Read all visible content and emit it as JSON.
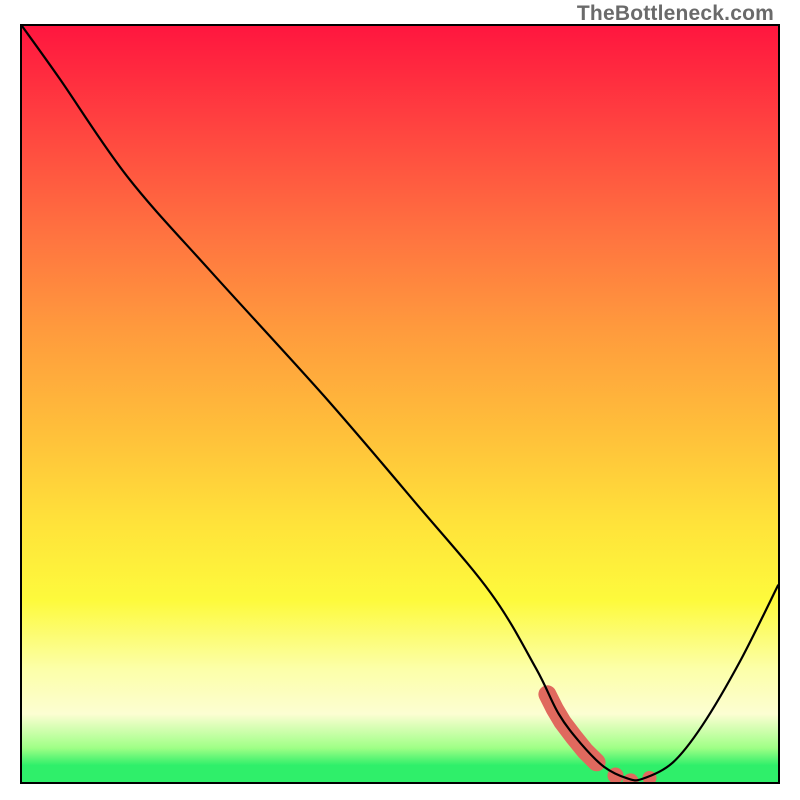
{
  "watermark": "TheBottleneck.com",
  "chart_data": {
    "type": "line",
    "title": "",
    "xlabel": "",
    "ylabel": "",
    "xlim": [
      0,
      100
    ],
    "ylim": [
      0,
      100
    ],
    "grid": false,
    "series": [
      {
        "name": "black-curve",
        "x": [
          0,
          5,
          14,
          25,
          40,
          52,
          62,
          68,
          71,
          74,
          77,
          80,
          82,
          86,
          90,
          95,
          100
        ],
        "values": [
          100,
          93,
          80,
          67.5,
          51,
          37,
          25,
          15,
          9,
          5,
          2,
          0.5,
          0.4,
          2.5,
          7.5,
          16,
          26
        ]
      }
    ],
    "annotations": {
      "red_stroke_region_x": [
        69.5,
        83.5
      ],
      "red_stroke_description": "thick coral dashed stroke tracing the valley bottom near minimum"
    },
    "background": "vertical rainbow gradient (red top to green bottom)",
    "colors": {
      "curve": "#000000",
      "accent_stroke": "#e0695e",
      "frame": "#000000"
    }
  }
}
